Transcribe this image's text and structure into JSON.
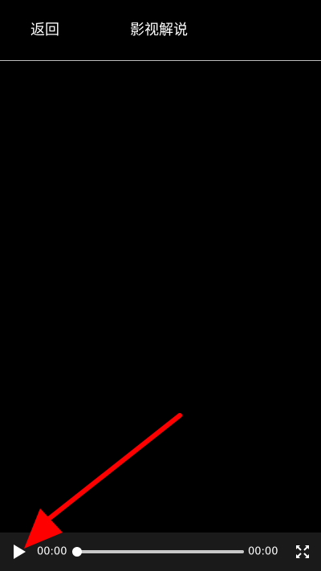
{
  "header": {
    "back_label": "返回",
    "title": "影视解说"
  },
  "player": {
    "current_time": "00:00",
    "total_time": "00:00",
    "progress": 0,
    "play_icon": "play-icon",
    "fullscreen_icon": "fullscreen-icon"
  },
  "colors": {
    "background": "#000000",
    "controls_bg": "#1a1a1a",
    "annotation_arrow": "#ff0000"
  }
}
